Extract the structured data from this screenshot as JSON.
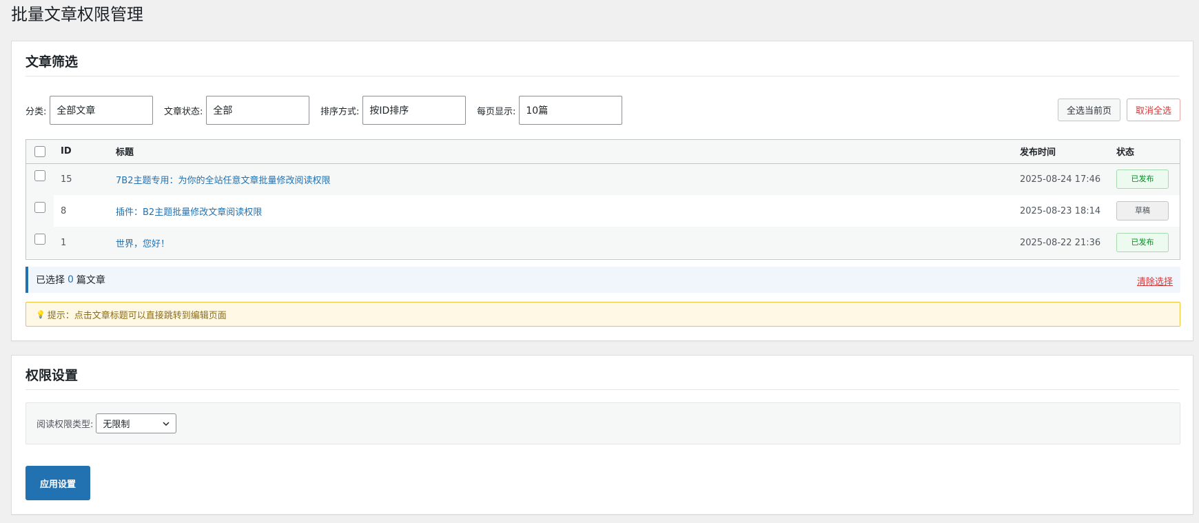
{
  "page": {
    "title": "批量文章权限管理"
  },
  "filter_section": {
    "title": "文章筛选",
    "category": {
      "label": "分类:",
      "value": "全部文章"
    },
    "status": {
      "label": "文章状态:",
      "value": "全部"
    },
    "sort": {
      "label": "排序方式:",
      "value": "按ID排序"
    },
    "per_page": {
      "label": "每页显示:",
      "value": "10篇"
    },
    "select_all_label": "全选当前页",
    "deselect_all_label": "取消全选"
  },
  "table": {
    "headers": {
      "id": "ID",
      "title": "标题",
      "date": "发布时间",
      "status": "状态"
    },
    "rows": [
      {
        "id": "15",
        "title": "7B2主题专用：为你的全站任意文章批量修改阅读权限",
        "date": "2025-08-24 17:46",
        "status": "已发布",
        "status_type": "published"
      },
      {
        "id": "8",
        "title": "插件：B2主题批量修改文章阅读权限",
        "date": "2025-08-23 18:14",
        "status": "草稿",
        "status_type": "draft"
      },
      {
        "id": "1",
        "title": "世界，您好！",
        "date": "2025-08-22 21:36",
        "status": "已发布",
        "status_type": "published"
      }
    ]
  },
  "selection": {
    "prefix": "已选择",
    "count": "0",
    "suffix": "篇文章",
    "clear_label": "清除选择"
  },
  "tip": {
    "icon": "lightbulb-icon",
    "text": "提示：点击文章标题可以直接跳转到编辑页面"
  },
  "permission_section": {
    "title": "权限设置",
    "read_type_label": "阅读权限类型:",
    "read_type_value": "无限制",
    "apply_label": "应用设置"
  },
  "colors": {
    "accent": "#2271b1",
    "danger": "#d63638",
    "published": "#008a20",
    "tip_bg": "#fff8e5"
  }
}
